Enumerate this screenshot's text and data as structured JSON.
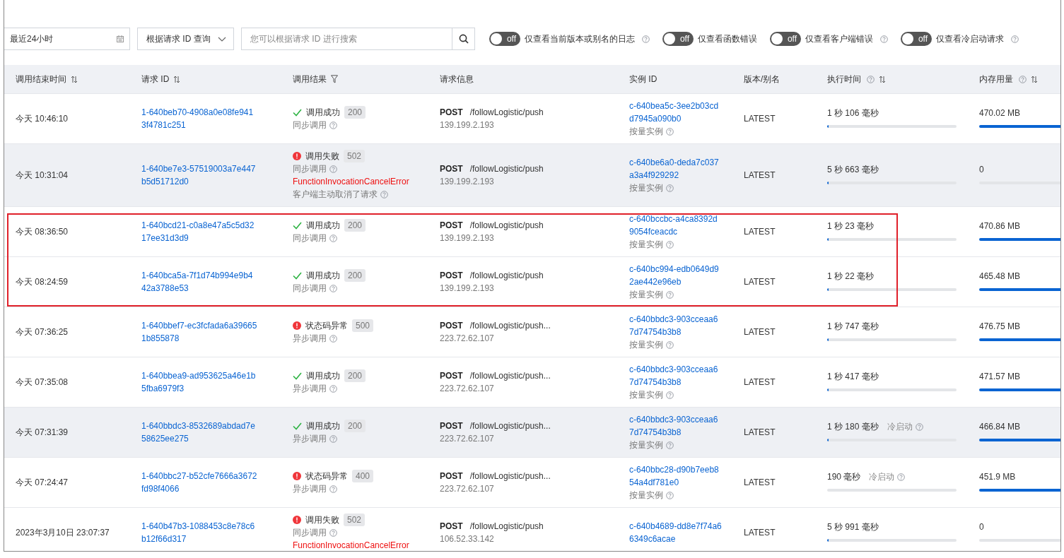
{
  "toolbar": {
    "time_range": "最近24小时",
    "query_type": "根据请求 ID 查询",
    "search": {
      "placeholder": "您可以根据请求 ID 进行搜索"
    },
    "filters": [
      {
        "label": "仅查看当前版本或别名的日志",
        "on": false,
        "toggle_text": "off",
        "help": true
      },
      {
        "label": "仅查看函数错误",
        "on": false,
        "toggle_text": "off",
        "help": false
      },
      {
        "label": "仅查看客户端错误",
        "on": false,
        "toggle_text": "off",
        "help": true
      },
      {
        "label": "仅查看冷启动请求",
        "on": false,
        "toggle_text": "off",
        "help": true
      }
    ]
  },
  "table": {
    "columns": [
      {
        "label": "调用结束时间",
        "sortable": true,
        "help": false,
        "filter": false
      },
      {
        "label": "请求 ID",
        "sortable": true,
        "help": false,
        "filter": false
      },
      {
        "label": "调用结果",
        "sortable": false,
        "help": false,
        "filter": true
      },
      {
        "label": "请求信息",
        "sortable": false,
        "help": false,
        "filter": false
      },
      {
        "label": "实例 ID",
        "sortable": false,
        "help": false,
        "filter": false
      },
      {
        "label": "版本/别名",
        "sortable": false,
        "help": false,
        "filter": false
      },
      {
        "label": "执行时间",
        "sortable": true,
        "help": true,
        "filter": false
      },
      {
        "label": "内存用量",
        "sortable": true,
        "help": true,
        "filter": false
      }
    ],
    "rows": [
      {
        "time": "今天 10:46:10",
        "request_id": "1-640beb70-4908a0e08fe9413f4781c251",
        "result": {
          "kind": "success",
          "label": "调用成功",
          "code": "200",
          "mode": "同步调用"
        },
        "method": "POST",
        "path": "/followLogistic/push",
        "ip": "139.199.2.193",
        "instance_id": "c-640bea5c-3ee2b03cdd7945a090b0",
        "instance_type": "按量实例",
        "version": "LATEST",
        "duration": {
          "text": "1 秒 106 毫秒",
          "level": 0.01
        },
        "memory": {
          "text": "470.02 MB",
          "level": 1
        },
        "shaded": false,
        "boxed": false
      },
      {
        "time": "今天 10:31:04",
        "request_id": "1-640be7e3-57519003a7e447b5d51712d0",
        "result": {
          "kind": "error",
          "label": "调用失败",
          "code": "502",
          "mode": "同步调用",
          "error": "FunctionInvocationCancelError",
          "reason": "客户端主动取消了请求"
        },
        "method": "POST",
        "path": "/followLogistic/push",
        "ip": "139.199.2.193",
        "instance_id": "c-640be6a0-deda7c037a3a4f929292",
        "instance_type": "按量实例",
        "version": "LATEST",
        "duration": {
          "text": "5 秒 663 毫秒",
          "level": 0.01
        },
        "memory": {
          "text": "0",
          "level": 0
        },
        "shaded": true,
        "boxed": false
      },
      {
        "time": "今天 08:36:50",
        "request_id": "1-640bcd21-c0a8e47a5c5d3217ee31d3d9",
        "result": {
          "kind": "success",
          "label": "调用成功",
          "code": "200",
          "mode": "同步调用"
        },
        "method": "POST",
        "path": "/followLogistic/push",
        "ip": "139.199.2.193",
        "instance_id": "c-640bccbc-a4ca8392d9054fceacdc",
        "instance_type": "按量实例",
        "version": "LATEST",
        "duration": {
          "text": "1 秒 23 毫秒",
          "level": 0.01
        },
        "memory": {
          "text": "470.86 MB",
          "level": 1
        },
        "shaded": false,
        "boxed": true
      },
      {
        "time": "今天 08:24:59",
        "request_id": "1-640bca5a-7f1d74b994e9b442a3788e53",
        "result": {
          "kind": "success",
          "label": "调用成功",
          "code": "200",
          "mode": "同步调用"
        },
        "method": "POST",
        "path": "/followLogistic/push",
        "ip": "139.199.2.193",
        "instance_id": "c-640bc994-edb0649d92ae442e96eb",
        "instance_type": "按量实例",
        "version": "LATEST",
        "duration": {
          "text": "1 秒 22 毫秒",
          "level": 0.01
        },
        "memory": {
          "text": "465.48 MB",
          "level": 1
        },
        "shaded": false,
        "boxed": true
      },
      {
        "time": "今天 07:36:25",
        "request_id": "1-640bbef7-ec3fcfada6a396651b855878",
        "result": {
          "kind": "error",
          "label": "状态码异常",
          "code": "500",
          "mode": "异步调用"
        },
        "method": "POST",
        "path": "/followLogistic/push...",
        "ip": "223.72.62.107",
        "instance_id": "c-640bbdc3-903cceaa67d74754b3b8",
        "instance_type": "按量实例",
        "version": "LATEST",
        "duration": {
          "text": "1 秒 747 毫秒",
          "level": 0.01
        },
        "memory": {
          "text": "476.75 MB",
          "level": 1
        },
        "shaded": false,
        "boxed": false
      },
      {
        "time": "今天 07:35:08",
        "request_id": "1-640bbea9-ad953625a46e1b5fba6979f3",
        "result": {
          "kind": "success",
          "label": "调用成功",
          "code": "200",
          "mode": "异步调用"
        },
        "method": "POST",
        "path": "/followLogistic/push...",
        "ip": "223.72.62.107",
        "instance_id": "c-640bbdc3-903cceaa67d74754b3b8",
        "instance_type": "按量实例",
        "version": "LATEST",
        "duration": {
          "text": "1 秒 417 毫秒",
          "level": 0.01
        },
        "memory": {
          "text": "471.57 MB",
          "level": 1
        },
        "shaded": false,
        "boxed": false
      },
      {
        "time": "今天 07:31:39",
        "request_id": "1-640bbdc3-8532689abdad7e58625ee275",
        "result": {
          "kind": "success",
          "label": "调用成功",
          "code": "200",
          "mode": "异步调用"
        },
        "method": "POST",
        "path": "/followLogistic/push...",
        "ip": "223.72.62.107",
        "instance_id": "c-640bbdc3-903cceaa67d74754b3b8",
        "instance_type": "按量实例",
        "version": "LATEST",
        "duration": {
          "text": "1 秒 180 毫秒",
          "cold_start": "冷启动",
          "level": 0.01
        },
        "memory": {
          "text": "466.84 MB",
          "level": 1
        },
        "shaded": true,
        "boxed": false
      },
      {
        "time": "今天 07:24:47",
        "request_id": "1-640bbc27-b52cfe7666a3672fd98f4066",
        "result": {
          "kind": "error",
          "label": "状态码异常",
          "code": "400",
          "mode": "异步调用"
        },
        "method": "POST",
        "path": "/followLogistic/push...",
        "ip": "223.72.62.107",
        "instance_id": "c-640bbc28-d90b7eeb854a4df781e0",
        "instance_type": "按量实例",
        "version": "LATEST",
        "duration": {
          "text": "190 毫秒",
          "cold_start": "冷启动",
          "level": 0
        },
        "memory": {
          "text": "451.9 MB",
          "level": 1
        },
        "shaded": false,
        "boxed": false
      },
      {
        "time": "2023年3月10日 23:07:37",
        "request_id": "1-640b47b3-1088453c8e78c6b12f66d317",
        "result": {
          "kind": "error",
          "label": "调用失败",
          "code": "502",
          "mode": "同步调用",
          "error": "FunctionInvocationCancelError"
        },
        "method": "POST",
        "path": "/followLogistic/push",
        "ip": "106.52.33.142",
        "instance_id": "c-640b4689-dd8e7f74a66349c6acae",
        "version": "LATEST",
        "duration": {
          "text": "5 秒 991 毫秒",
          "level": 0.01
        },
        "memory": {
          "text": "0",
          "level": 0
        },
        "shaded": false,
        "boxed": false
      }
    ]
  }
}
